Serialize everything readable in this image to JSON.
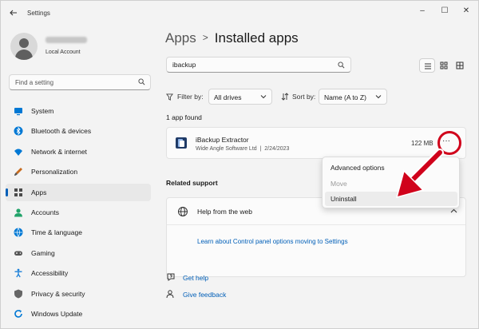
{
  "window": {
    "title": "Settings",
    "minimize": "–",
    "maximize": "☐",
    "close": "✕"
  },
  "profile": {
    "account_type": "Local Account"
  },
  "sidebar": {
    "search_placeholder": "Find a setting",
    "items": [
      {
        "label": "System",
        "icon": "system-icon",
        "color": "#0078d4"
      },
      {
        "label": "Bluetooth & devices",
        "icon": "bluetooth-icon",
        "color": "#0078d4"
      },
      {
        "label": "Network & internet",
        "icon": "wifi-icon",
        "color": "#0078d4"
      },
      {
        "label": "Personalization",
        "icon": "brush-icon",
        "color": "#c86b1d"
      },
      {
        "label": "Apps",
        "icon": "apps-icon",
        "color": "#4a4a4a"
      },
      {
        "label": "Accounts",
        "icon": "person-icon",
        "color": "#22a36a"
      },
      {
        "label": "Time & language",
        "icon": "globe-icon",
        "color": "#0078d4"
      },
      {
        "label": "Gaming",
        "icon": "gamepad-icon",
        "color": "#555555"
      },
      {
        "label": "Accessibility",
        "icon": "accessibility-icon",
        "color": "#1a7fd8"
      },
      {
        "label": "Privacy & security",
        "icon": "shield-icon",
        "color": "#666666"
      },
      {
        "label": "Windows Update",
        "icon": "update-icon",
        "color": "#0078d4"
      }
    ],
    "active_index": 4
  },
  "main": {
    "breadcrumb_parent": "Apps",
    "breadcrumb_current": "Installed apps",
    "search_value": "ibackup",
    "filter_label": "Filter by:",
    "filter_value": "All drives",
    "sort_label": "Sort by:",
    "sort_value": "Name (A to Z)",
    "count_text": "1 app found",
    "app": {
      "name": "iBackup Extractor",
      "publisher": "Wide Angle Software Ltd",
      "separator": "|",
      "date": "2/24/2023",
      "size": "122 MB",
      "more": "···"
    },
    "context_menu": [
      "Advanced options",
      "Move",
      "Uninstall"
    ],
    "related_title": "Related support",
    "support": {
      "label": "Help from the web",
      "link": "Learn about Control panel options moving to Settings"
    },
    "footer": [
      {
        "label": "Get help",
        "icon": "help-icon"
      },
      {
        "label": "Give feedback",
        "icon": "feedback-icon"
      }
    ]
  },
  "colors": {
    "accent": "#005fb8",
    "annotation": "#d0021b"
  }
}
